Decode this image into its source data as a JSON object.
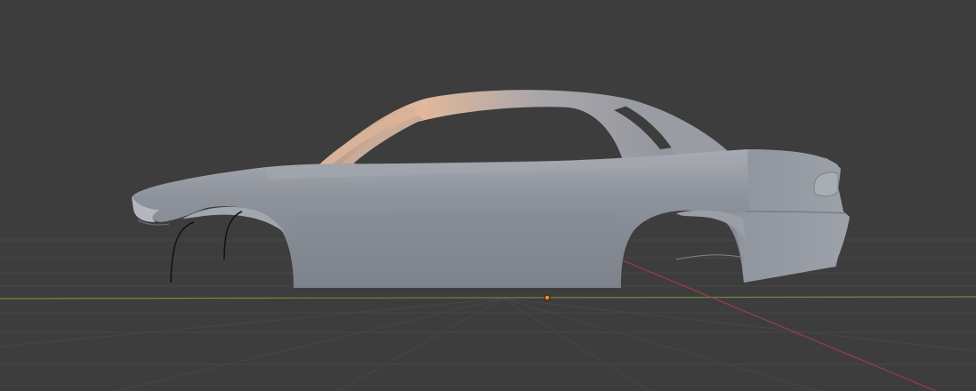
{
  "viewport": {
    "background": "#3d3d3d",
    "grid_color": "#4a4a4a",
    "x_axis_color": "#9a3e4a",
    "y_axis_color": "#6f8a37",
    "origin_color": "#f08a1c",
    "model_color": "#8a8f98",
    "highlight_color": "#e8b48a",
    "view": "perspective",
    "object": "car-body-mesh"
  }
}
